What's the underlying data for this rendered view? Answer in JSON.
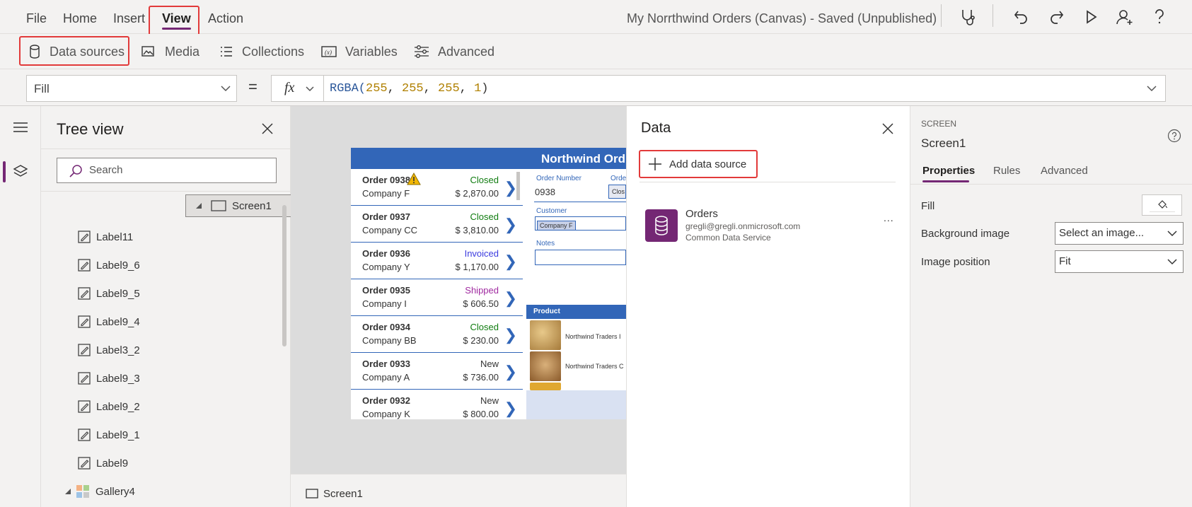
{
  "menu": {
    "items": [
      "File",
      "Home",
      "Insert",
      "View",
      "Action"
    ],
    "app_title": "My Norrthwind Orders (Canvas) - Saved (Unpublished)"
  },
  "toolbar": {
    "items": [
      "Data sources",
      "Media",
      "Collections",
      "Variables",
      "Advanced"
    ]
  },
  "formula_bar": {
    "property": "Fill",
    "equals": "=",
    "fx": "fx",
    "fn": "RGBA(",
    "args": [
      "255",
      "255",
      "255",
      "1"
    ],
    "sep": ", ",
    "close": ")"
  },
  "tree": {
    "title": "Tree view",
    "search_placeholder": "Search",
    "items": [
      {
        "label": "Screen1",
        "icon": "screen-icon",
        "level": 0
      },
      {
        "label": "Label11",
        "icon": "label-icon",
        "level": 1
      },
      {
        "label": "Label9_6",
        "icon": "label-icon",
        "level": 1
      },
      {
        "label": "Label9_5",
        "icon": "label-icon",
        "level": 1
      },
      {
        "label": "Label9_4",
        "icon": "label-icon",
        "level": 1
      },
      {
        "label": "Label3_2",
        "icon": "label-icon",
        "level": 1
      },
      {
        "label": "Label9_3",
        "icon": "label-icon",
        "level": 1
      },
      {
        "label": "Label9_2",
        "icon": "label-icon",
        "level": 1
      },
      {
        "label": "Label9_1",
        "icon": "label-icon",
        "level": 1
      },
      {
        "label": "Label9",
        "icon": "label-icon",
        "level": 1
      },
      {
        "label": "Gallery4",
        "icon": "gallery-icon",
        "level": 1
      }
    ]
  },
  "app": {
    "header": "Northwind Ord",
    "orders": [
      {
        "number": "Order 0938",
        "company": "Company F",
        "status": "Closed",
        "amount": "$ 2,870.00",
        "status_color": "#107c10"
      },
      {
        "number": "Order 0937",
        "company": "Company CC",
        "status": "Closed",
        "amount": "$ 3,810.00",
        "status_color": "#107c10"
      },
      {
        "number": "Order 0936",
        "company": "Company Y",
        "status": "Invoiced",
        "amount": "$ 1,170.00",
        "status_color": "#3b3bdf"
      },
      {
        "number": "Order 0935",
        "company": "Company I",
        "status": "Shipped",
        "amount": "$ 606.50",
        "status_color": "#a02aa0"
      },
      {
        "number": "Order 0934",
        "company": "Company BB",
        "status": "Closed",
        "amount": "$ 230.00",
        "status_color": "#107c10"
      },
      {
        "number": "Order 0933",
        "company": "Company A",
        "status": "New",
        "amount": "$ 736.00",
        "status_color": "#333333"
      },
      {
        "number": "Order 0932",
        "company": "Company K",
        "status": "New",
        "amount": "$ 800.00",
        "status_color": "#333333"
      }
    ],
    "detail": {
      "order_number_label": "Order Number",
      "order_number": "0938",
      "order_status_label": "Orde",
      "status_value": "Clos",
      "customer_label": "Customer",
      "customer_value": "Company F",
      "notes_label": "Notes",
      "product_header": "Product",
      "products": [
        "Northwind Traders I",
        "Northwind Traders C"
      ]
    }
  },
  "status_bar": {
    "screen": "Screen1"
  },
  "data_panel": {
    "title": "Data",
    "add_label": "Add data source",
    "sources": [
      {
        "name": "Orders",
        "account": "gregli@gregli.onmicrosoft.com",
        "type": "Common Data Service",
        "more": "..."
      }
    ]
  },
  "properties": {
    "section": "SCREEN",
    "name": "Screen1",
    "tabs": [
      "Properties",
      "Rules",
      "Advanced"
    ],
    "fill_label": "Fill",
    "bg_image_label": "Background image",
    "bg_image_value": "Select an image...",
    "image_position_label": "Image position",
    "image_position_value": "Fit"
  },
  "colors": {
    "accent": "#742774",
    "app_blue": "#3266b8",
    "highlight": "#e23a3a"
  }
}
